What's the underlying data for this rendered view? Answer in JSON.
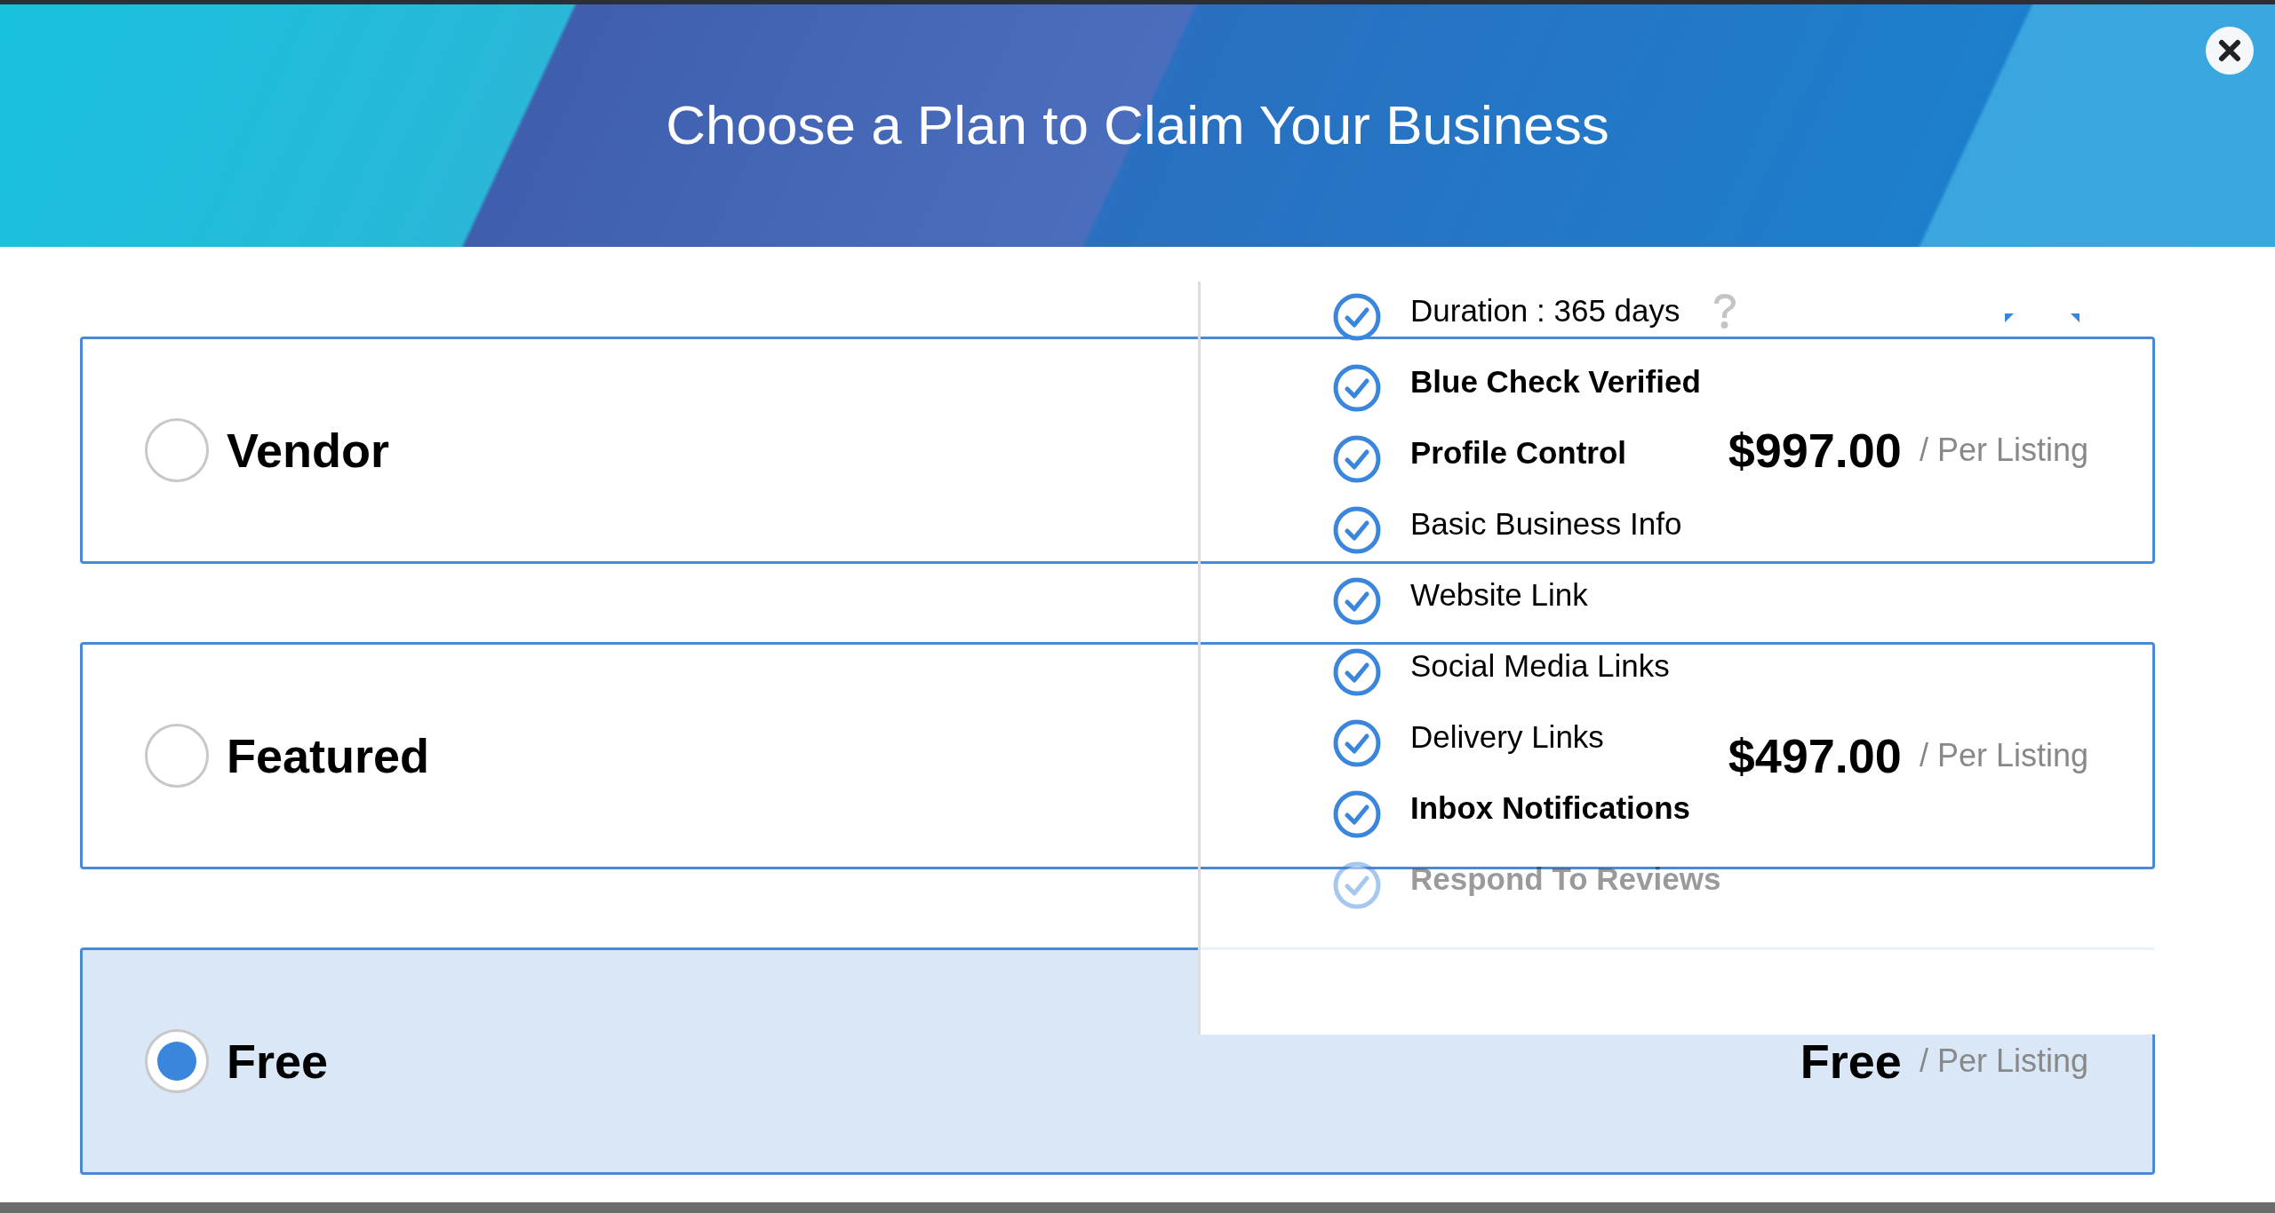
{
  "dialog": {
    "title": "Choose a Plan to Claim Your Business"
  },
  "plans": [
    {
      "name": "Vendor",
      "price": "$997.00",
      "unit": "/ Per Listing",
      "selected": false
    },
    {
      "name": "Featured",
      "price": "$497.00",
      "unit": "/ Per Listing",
      "selected": false
    },
    {
      "name": "Free",
      "price": "Free",
      "unit": "/ Per Listing",
      "selected": true
    }
  ],
  "features": [
    {
      "text": "Duration : 365 days",
      "bold": false,
      "help": true,
      "faded": false
    },
    {
      "text": "Blue Check Verified",
      "bold": true,
      "help": false,
      "faded": false
    },
    {
      "text": "Profile Control",
      "bold": true,
      "help": false,
      "faded": false
    },
    {
      "text": "Basic Business Info",
      "bold": false,
      "help": false,
      "faded": false
    },
    {
      "text": "Website Link",
      "bold": false,
      "help": false,
      "faded": false
    },
    {
      "text": "Social Media Links",
      "bold": false,
      "help": false,
      "faded": false
    },
    {
      "text": "Delivery Links",
      "bold": false,
      "help": false,
      "faded": false
    },
    {
      "text": "Inbox Notifications",
      "bold": true,
      "help": false,
      "faded": false
    },
    {
      "text": "Respond To Reviews",
      "bold": true,
      "help": false,
      "faded": true
    }
  ]
}
